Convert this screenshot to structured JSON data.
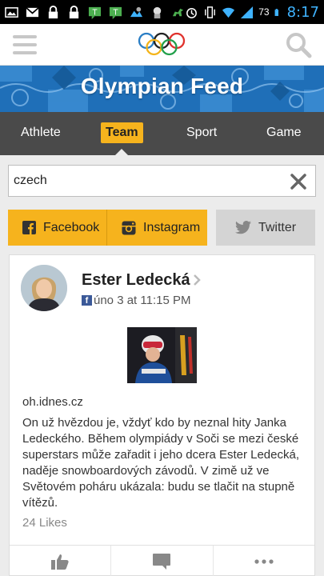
{
  "status_bar": {
    "battery_level": "73",
    "time": "8:17",
    "icons": [
      "image-icon",
      "gmail-icon",
      "lock-icon",
      "lock-icon",
      "messaging-icon",
      "messaging-icon",
      "weather-icon",
      "app-icon",
      "dinosaur-icon",
      "alarm-icon",
      "vibrate-icon",
      "wifi-icon",
      "signal-icon",
      "battery-icon"
    ]
  },
  "header": {
    "logo": "olympic-rings-icon",
    "banner_title": "Olympian Feed"
  },
  "tabs": [
    {
      "label": "Athlete",
      "active": false
    },
    {
      "label": "Team",
      "active": true
    },
    {
      "label": "Sport",
      "active": false
    },
    {
      "label": "Game",
      "active": false
    }
  ],
  "search": {
    "value": "czech",
    "placeholder": ""
  },
  "social_buttons": {
    "facebook": "Facebook",
    "instagram": "Instagram",
    "twitter": "Twitter"
  },
  "post": {
    "author": "Ester Ledecká",
    "source_network": "facebook",
    "date": "úno 3 at 11:15 PM",
    "link_source": "oh.idnes.cz",
    "text": "On už hvězdou je, vždyť kdo by neznal hity Janka Ledeckého. Během olympiády v Soči se mezi české superstars může zařadit i jeho dcera Ester Ledecká, naděje snowboardových závodů. V zimě už ve Světovém poháru ukázala: budu se tlačit na stupně vítězů.",
    "likes": "24 Likes",
    "actions": [
      "like-icon",
      "comment-icon",
      "more-icon"
    ]
  },
  "colors": {
    "accent": "#f6b31d",
    "tab_bar": "#4a4a4a",
    "banner": "#1f6fb8",
    "clock": "#3fb3ff"
  }
}
